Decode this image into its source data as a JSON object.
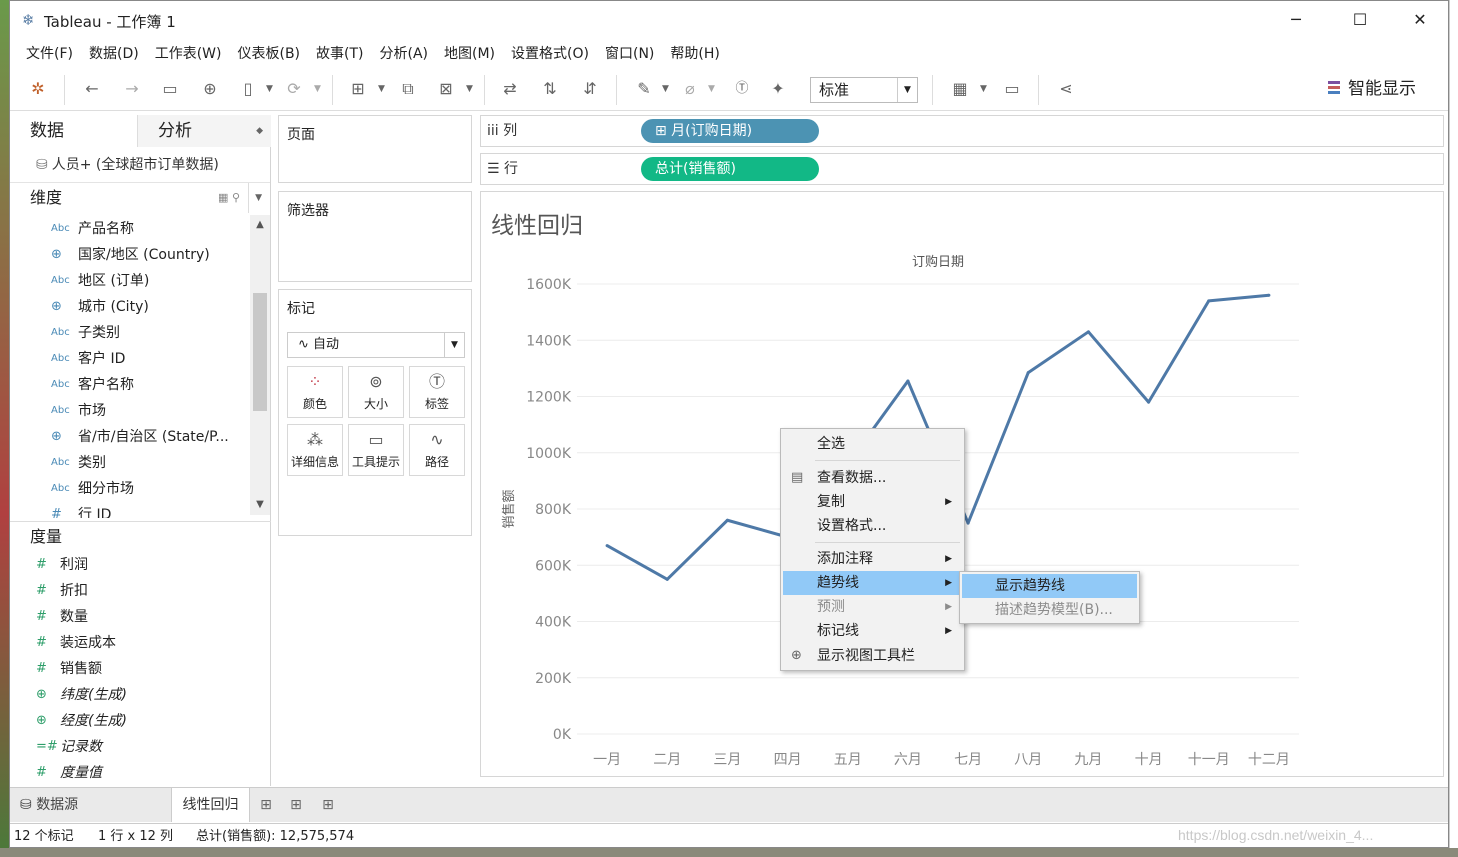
{
  "window": {
    "title": "Tableau - 工作簿 1",
    "minimize": "─",
    "maximize": "☐",
    "close": "✕"
  },
  "menubar": [
    "文件(F)",
    "数据(D)",
    "工作表(W)",
    "仪表板(B)",
    "故事(T)",
    "分析(A)",
    "地图(M)",
    "设置格式(O)",
    "窗口(N)",
    "帮助(H)"
  ],
  "toolbar": {
    "fit_select": "标准",
    "show_me": "智能显示"
  },
  "data_pane": {
    "tabs": [
      "数据",
      "分析"
    ],
    "datasource": "人员+ (全球超市订单数据)",
    "dimensions_label": "维度",
    "dimensions": [
      {
        "icon": "Abc",
        "label": "产品名称"
      },
      {
        "icon": "globe",
        "label": "国家/地区 (Country)"
      },
      {
        "icon": "Abc",
        "label": "地区 (订单)"
      },
      {
        "icon": "globe",
        "label": "城市 (City)"
      },
      {
        "icon": "Abc",
        "label": "子类别"
      },
      {
        "icon": "Abc",
        "label": "客户 ID"
      },
      {
        "icon": "Abc",
        "label": "客户名称"
      },
      {
        "icon": "Abc",
        "label": "市场"
      },
      {
        "icon": "globe",
        "label": "省/市/自治区 (State/P..."
      },
      {
        "icon": "Abc",
        "label": "类别"
      },
      {
        "icon": "Abc",
        "label": "细分市场"
      },
      {
        "icon": "#",
        "label": "行 ID"
      }
    ],
    "measures_label": "度量",
    "measures": [
      {
        "icon": "#",
        "label": "利润",
        "italic": false
      },
      {
        "icon": "#",
        "label": "折扣",
        "italic": false
      },
      {
        "icon": "#",
        "label": "数量",
        "italic": false
      },
      {
        "icon": "#",
        "label": "装运成本",
        "italic": false
      },
      {
        "icon": "#",
        "label": "销售额",
        "italic": false
      },
      {
        "icon": "globe",
        "label": "纬度(生成)",
        "italic": true
      },
      {
        "icon": "globe",
        "label": "经度(生成)",
        "italic": true
      },
      {
        "icon": "=#",
        "label": "记录数",
        "italic": true
      },
      {
        "icon": "#",
        "label": "度量值",
        "italic": true
      }
    ]
  },
  "shelves": {
    "pages": "页面",
    "filters": "筛选器",
    "marks": "标记",
    "mark_type": "自动",
    "mark_buttons": [
      "颜色",
      "大小",
      "标签",
      "详细信息",
      "工具提示",
      "路径"
    ],
    "columns_label": "列",
    "columns_pill": "⊞ 月(订购日期)",
    "rows_label": "行",
    "rows_pill": "总计(销售额)"
  },
  "view": {
    "title": "线性回归"
  },
  "chart_data": {
    "type": "line",
    "title": "线性回归",
    "xlabel": "订购日期",
    "ylabel": "销售额",
    "categories": [
      "一月",
      "二月",
      "三月",
      "四月",
      "五月",
      "六月",
      "七月",
      "八月",
      "九月",
      "十月",
      "十一月",
      "十二月"
    ],
    "series": [
      {
        "values": [
          670000,
          550000,
          760000,
          700000,
          960000,
          1255000,
          750000,
          1285000,
          1430000,
          1180000,
          1540000,
          1560000
        ]
      }
    ],
    "y_ticks": [
      "0K",
      "200K",
      "400K",
      "600K",
      "800K",
      "1000K",
      "1200K",
      "1400K",
      "1600K"
    ],
    "ylim": [
      0,
      1600000
    ],
    "line_color": "#4e79a7",
    "grid": true
  },
  "context_menu": {
    "items": [
      "全选",
      "查看数据...",
      "复制",
      "设置格式...",
      "添加注释",
      "趋势线",
      "预测",
      "标记线",
      "显示视图工具栏"
    ],
    "submenu": [
      "显示趋势线",
      "描述趋势模型(B)..."
    ]
  },
  "bottom_tabs": {
    "datasource": "数据源",
    "sheet": "线性回归"
  },
  "status": {
    "marks": "12 个标记",
    "dims": "1 行 x 12 列",
    "sum": "总计(销售额): 12,575,574"
  },
  "watermark": "https://blog.csdn.net/weixin_4..."
}
